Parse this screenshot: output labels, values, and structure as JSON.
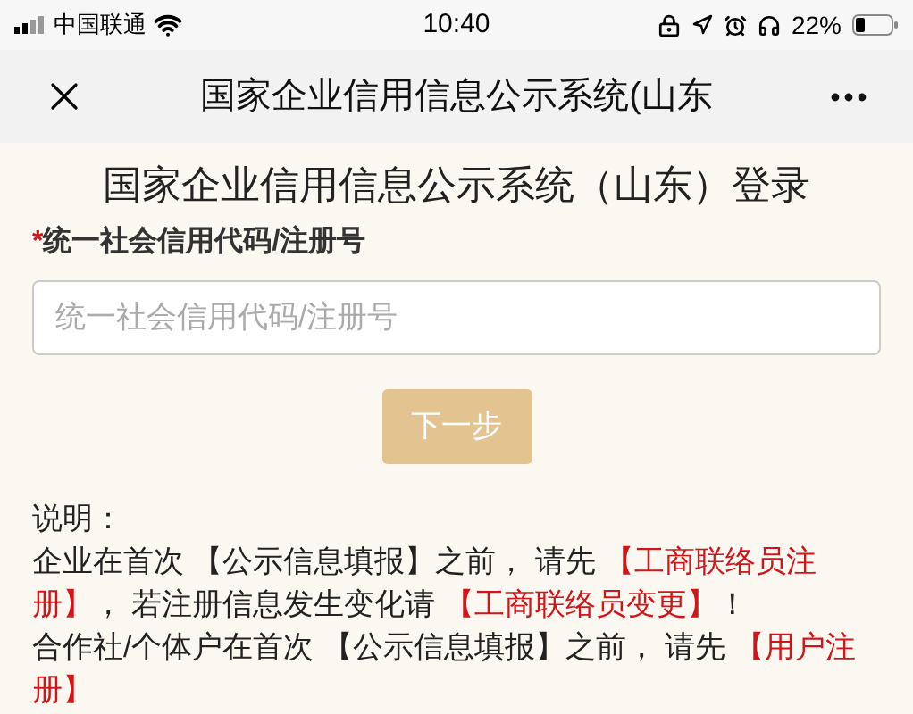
{
  "status_bar": {
    "carrier": "中国联通",
    "time": "10:40",
    "battery": "22%"
  },
  "nav_bar": {
    "title": "国家企业信用信息公示系统(山东"
  },
  "page": {
    "heading": "国家企业信用信息公示系统（山东）登录",
    "field": {
      "required_mark": "*",
      "label": "统一社会信用代码/注册号",
      "placeholder": "统一社会信用代码/注册号"
    },
    "next_button": "下一步",
    "note_title": "说明：",
    "note_lines": [
      [
        {
          "kind": "plain",
          "text": "企业在首次 【公示信息填报】之前， 请先 "
        },
        {
          "kind": "link",
          "text": "【工商联络员注"
        }
      ],
      [
        {
          "kind": "link",
          "text": "册】"
        },
        {
          "kind": "plain",
          "text": "， 若注册信息发生变化请 "
        },
        {
          "kind": "link",
          "text": "【工商联络员变更】"
        },
        {
          "kind": "plain",
          "text": "！"
        }
      ],
      [
        {
          "kind": "plain",
          "text": "合作社/个体户在首次 【公示信息填报】之前， 请先 "
        },
        {
          "kind": "link",
          "text": "【用户注"
        }
      ],
      [
        {
          "kind": "link",
          "text": "册】"
        }
      ]
    ]
  }
}
